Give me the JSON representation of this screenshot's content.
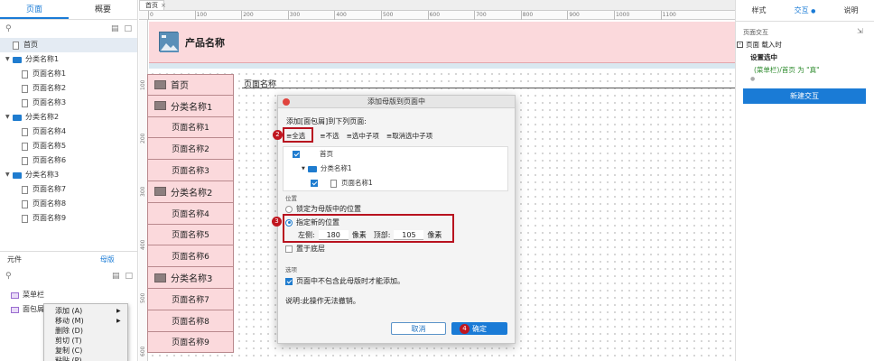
{
  "left": {
    "tabs": [
      "页面",
      "概要"
    ],
    "pages": [
      {
        "label": "首页",
        "type": "page",
        "level": 0,
        "selected": true
      },
      {
        "label": "分类名称1",
        "type": "folder",
        "level": 0
      },
      {
        "label": "页面名称1",
        "type": "page",
        "level": 1
      },
      {
        "label": "页面名称2",
        "type": "page",
        "level": 1
      },
      {
        "label": "页面名称3",
        "type": "page",
        "level": 1
      },
      {
        "label": "分类名称2",
        "type": "folder",
        "level": 0
      },
      {
        "label": "页面名称4",
        "type": "page",
        "level": 1
      },
      {
        "label": "页面名称5",
        "type": "page",
        "level": 1
      },
      {
        "label": "页面名称6",
        "type": "page",
        "level": 1
      },
      {
        "label": "分类名称3",
        "type": "folder",
        "level": 0
      },
      {
        "label": "页面名称7",
        "type": "page",
        "level": 1
      },
      {
        "label": "页面名称8",
        "type": "page",
        "level": 1
      },
      {
        "label": "页面名称9",
        "type": "page",
        "level": 1
      }
    ],
    "bottom_tabs": [
      "元件",
      "母版"
    ],
    "masters": [
      "菜单栏",
      "面包屑"
    ],
    "context_menu": [
      {
        "label": "添加 (A)",
        "submenu": true
      },
      {
        "label": "移动 (M)",
        "submenu": true
      },
      {
        "label": "删除 (D)",
        "submenu": false
      },
      {
        "label": "剪切 (T)",
        "submenu": false
      },
      {
        "label": "复制 (C)",
        "submenu": false
      },
      {
        "label": "粘贴 (P)",
        "submenu": false
      }
    ]
  },
  "canvas": {
    "page_tab": "首页",
    "ruler_h": [
      "0",
      "100",
      "200",
      "300",
      "400",
      "500",
      "600",
      "700",
      "800",
      "900",
      "1000",
      "1100"
    ],
    "ruler_v": [
      "100",
      "200",
      "300",
      "400",
      "500",
      "600"
    ],
    "product_name": "产品名称",
    "menu": [
      {
        "label": "首页",
        "level": 1
      },
      {
        "label": "分类名称1",
        "level": 1
      },
      {
        "label": "页面名称1",
        "level": 2
      },
      {
        "label": "页面名称2",
        "level": 2
      },
      {
        "label": "页面名称3",
        "level": 2
      },
      {
        "label": "分类名称2",
        "level": 1
      },
      {
        "label": "页面名称4",
        "level": 2
      },
      {
        "label": "页面名称5",
        "level": 2
      },
      {
        "label": "页面名称6",
        "level": 2
      },
      {
        "label": "分类名称3",
        "level": 1
      },
      {
        "label": "页面名称7",
        "level": 2
      },
      {
        "label": "页面名称8",
        "level": 2
      },
      {
        "label": "页面名称9",
        "level": 2
      }
    ],
    "breadcrumb": "页面名称"
  },
  "dialog": {
    "title": "添加母版到页面中",
    "add_to_label": "添加[面包屑]到下列页面:",
    "select_all": "全选",
    "select_none": "不选",
    "select_children": "选中子项",
    "deselect_children": "取消选中子项",
    "list": [
      {
        "label": "首页",
        "checked": true,
        "indent": 0
      },
      {
        "label": "分类名称1",
        "checked": null,
        "indent": 1
      },
      {
        "label": "页面名称1",
        "checked": true,
        "indent": 2
      }
    ],
    "position_label": "位置",
    "opt_lock": "锁定为母版中的位置",
    "opt_new": "指定新的位置",
    "left_label": "左侧:",
    "left_value": "180",
    "px1": "像素",
    "top_label": "顶部:",
    "top_value": "105",
    "px2": "像素",
    "bottom_layer": "置于底层",
    "options_label": "选项",
    "only_if_absent": "页面中不包含此母版时才能添加。",
    "note": "说明:此操作无法撤销。",
    "cancel": "取消",
    "ok": "确定",
    "badges": [
      "2",
      "3",
      "4"
    ]
  },
  "right": {
    "tabs": [
      "样式",
      "交互",
      "说明"
    ],
    "section": "页面交互",
    "event": "页面 载入时",
    "action": "设置选中",
    "detail": "(菜单栏)/首页 为 \"真\"",
    "new_interaction": "新建交互",
    "accent": "#1a7bd6"
  }
}
